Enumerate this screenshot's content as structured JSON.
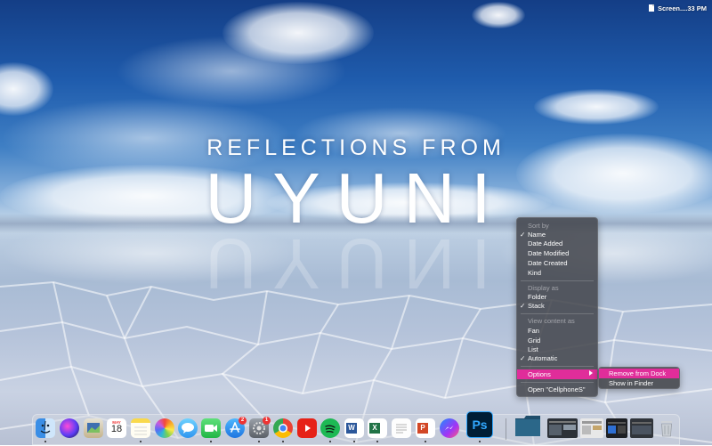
{
  "desktop": {
    "title_line1": "REFLECTIONS FROM",
    "title_line2": "UYUNI"
  },
  "menubar": {
    "status_text": "Screen....33 PM"
  },
  "context_menu": {
    "sort_by_header": "Sort by",
    "sort_items": [
      "Name",
      "Date Added",
      "Date Modified",
      "Date Created",
      "Kind"
    ],
    "display_as_header": "Display as",
    "display_items": [
      "Folder",
      "Stack"
    ],
    "view_content_header": "View content as",
    "view_items": [
      "Fan",
      "Grid",
      "List",
      "Automatic"
    ],
    "options_label": "Options",
    "open_label": "Open \"CellphoneS\"",
    "checkmark": "✓",
    "submenu": {
      "remove_label": "Remove from Dock",
      "finder_label": "Show in Finder"
    },
    "highlight_color": "#e02d9a"
  },
  "dock": {
    "calendar_month": "MAY",
    "calendar_day": "18",
    "appstore_badge": "2",
    "prefs_badge": "1",
    "word_letter": "W",
    "excel_letter": "X",
    "powerpoint_letter": "P",
    "photoshop_label": "Ps"
  }
}
